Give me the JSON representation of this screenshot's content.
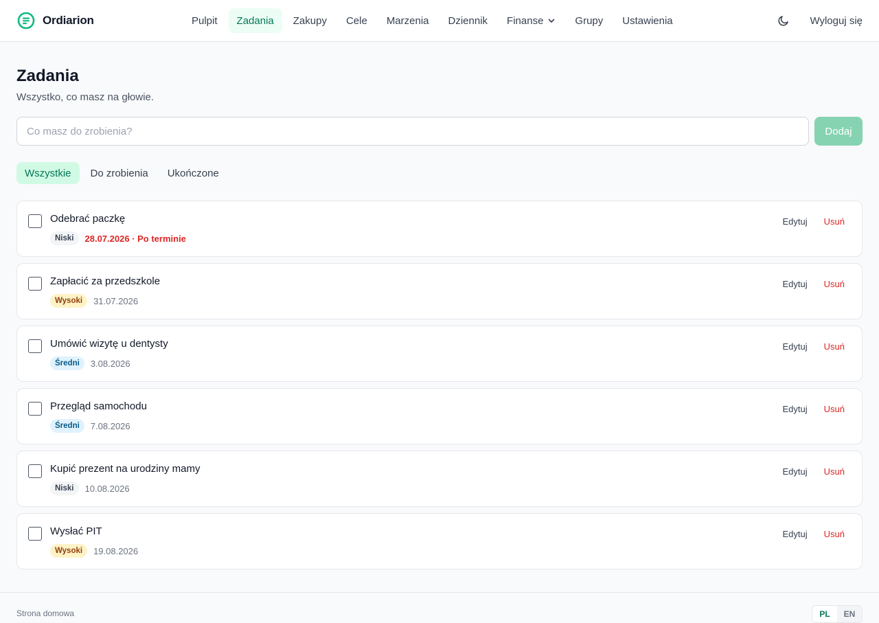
{
  "brand": {
    "name": "Ordiarion"
  },
  "nav": {
    "items": [
      {
        "label": "Pulpit",
        "active": false
      },
      {
        "label": "Zadania",
        "active": true
      },
      {
        "label": "Zakupy",
        "active": false
      },
      {
        "label": "Cele",
        "active": false
      },
      {
        "label": "Marzenia",
        "active": false
      },
      {
        "label": "Dziennik",
        "active": false
      },
      {
        "label": "Finanse",
        "active": false,
        "dropdown": true
      },
      {
        "label": "Grupy",
        "active": false
      },
      {
        "label": "Ustawienia",
        "active": false
      }
    ],
    "logout_label": "Wyloguj się",
    "theme_icon": "moon-icon"
  },
  "page": {
    "title": "Zadania",
    "subtitle": "Wszystko, co masz na głowie."
  },
  "add_form": {
    "placeholder": "Co masz do zrobienia?",
    "value": "",
    "button_label": "Dodaj"
  },
  "filters": [
    {
      "label": "Wszystkie",
      "active": true
    },
    {
      "label": "Do zrobienia",
      "active": false
    },
    {
      "label": "Ukończone",
      "active": false
    }
  ],
  "tasks": [
    {
      "title": "Odebrać paczkę",
      "priority": "Niski",
      "priority_level": "low",
      "due": "28.07.2026 · Po terminie",
      "overdue": true,
      "done": false,
      "edit_label": "Edytuj",
      "delete_label": "Usuń"
    },
    {
      "title": "Zapłacić za przedszkole",
      "priority": "Wysoki",
      "priority_level": "high",
      "due": "31.07.2026",
      "overdue": false,
      "done": false,
      "edit_label": "Edytuj",
      "delete_label": "Usuń"
    },
    {
      "title": "Umówić wizytę u dentysty",
      "priority": "Średni",
      "priority_level": "mid",
      "due": "3.08.2026",
      "overdue": false,
      "done": false,
      "edit_label": "Edytuj",
      "delete_label": "Usuń"
    },
    {
      "title": "Przegląd samochodu",
      "priority": "Średni",
      "priority_level": "mid",
      "due": "7.08.2026",
      "overdue": false,
      "done": false,
      "edit_label": "Edytuj",
      "delete_label": "Usuń"
    },
    {
      "title": "Kupić prezent na urodziny mamy",
      "priority": "Niski",
      "priority_level": "low",
      "due": "10.08.2026",
      "overdue": false,
      "done": false,
      "edit_label": "Edytuj",
      "delete_label": "Usuń"
    },
    {
      "title": "Wysłać PIT",
      "priority": "Wysoki",
      "priority_level": "high",
      "due": "19.08.2026",
      "overdue": false,
      "done": false,
      "edit_label": "Edytuj",
      "delete_label": "Usuń"
    }
  ],
  "footer": {
    "home_link": "Strona domowa",
    "languages": [
      {
        "code": "PL",
        "active": true
      },
      {
        "code": "EN",
        "active": false
      }
    ]
  },
  "colors": {
    "accent": "#047857",
    "accent_bg": "#ecfdf5",
    "danger": "#dc2626",
    "button_disabled": "#86d3b1"
  }
}
